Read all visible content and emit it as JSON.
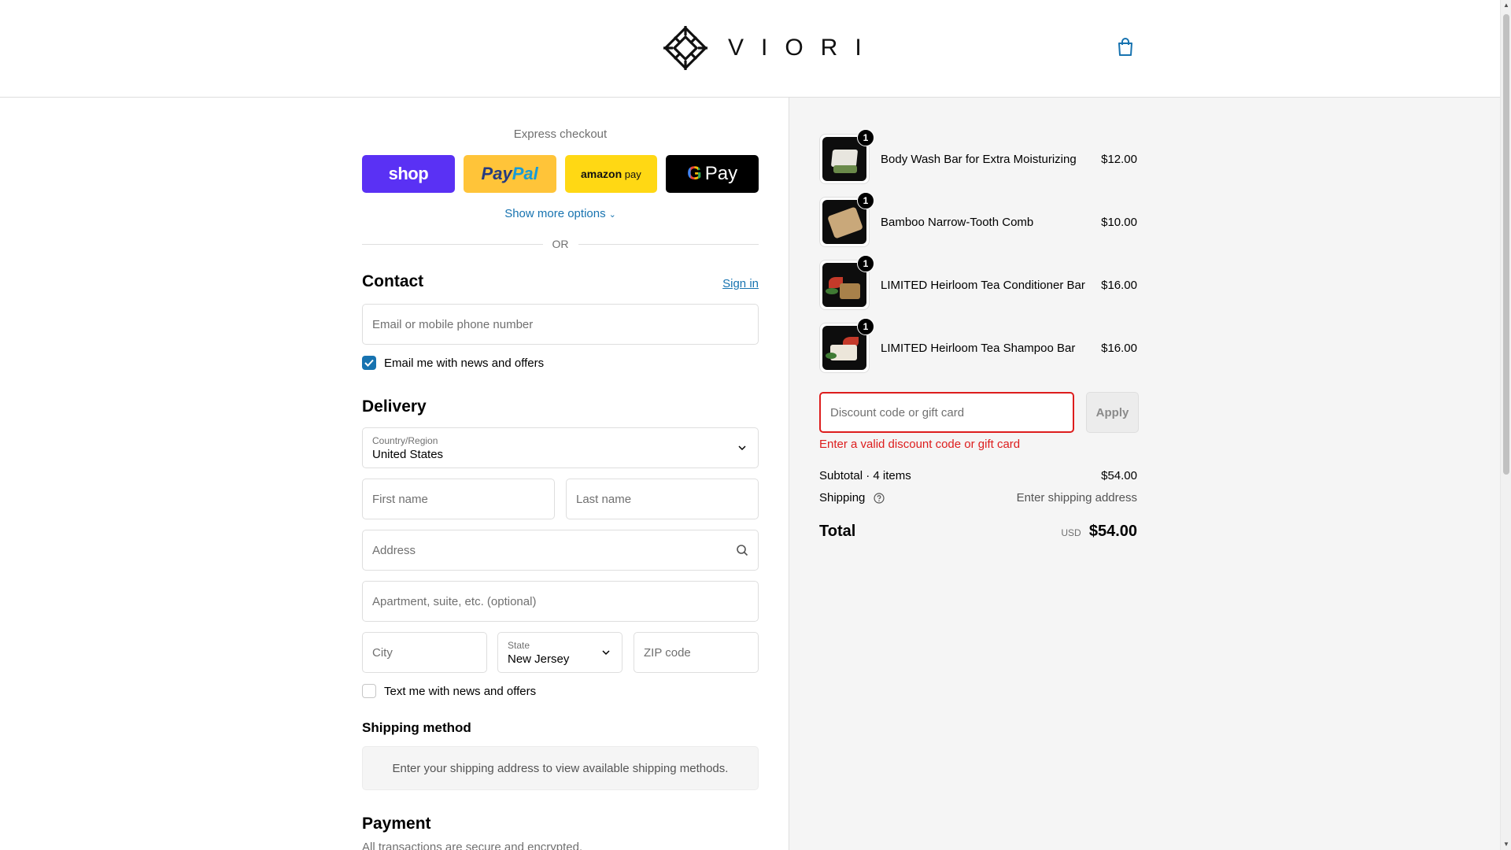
{
  "brand": {
    "name": "VIORI",
    "logo_icon": "viori-diamond-logo"
  },
  "header": {
    "cart_icon": "shopping-bag-icon"
  },
  "express": {
    "title": "Express checkout",
    "buttons": [
      {
        "id": "shop",
        "label": "shop"
      },
      {
        "id": "paypal",
        "label_a": "Pay",
        "label_b": "Pal"
      },
      {
        "id": "amazon",
        "label_a": "amazon",
        "label_b": "pay"
      },
      {
        "id": "gpay",
        "label_g": "G",
        "label": "Pay"
      }
    ],
    "more_options": "Show more options",
    "or": "OR"
  },
  "contact": {
    "title": "Contact",
    "signin": "Sign in",
    "email_placeholder": "Email or mobile phone number",
    "email_news": "Email me with news and offers",
    "email_news_checked": true
  },
  "delivery": {
    "title": "Delivery",
    "country_label": "Country/Region",
    "country_value": "United States",
    "first_name": "First name",
    "last_name": "Last name",
    "address": "Address",
    "apartment": "Apartment, suite, etc. (optional)",
    "city": "City",
    "state_label": "State",
    "state_value": "New Jersey",
    "zip": "ZIP code",
    "text_news": "Text me with news and offers",
    "text_news_checked": false
  },
  "shipping_method": {
    "title": "Shipping method",
    "info": "Enter your shipping address to view available shipping methods."
  },
  "payment": {
    "title": "Payment",
    "subtitle": "All transactions are secure and encrypted."
  },
  "summary": {
    "items": [
      {
        "name": "Body Wash Bar for Extra Moisturizing",
        "price": "$12.00",
        "qty": "1"
      },
      {
        "name": "Bamboo Narrow-Tooth Comb",
        "price": "$10.00",
        "qty": "1"
      },
      {
        "name": "LIMITED Heirloom Tea Conditioner Bar",
        "price": "$16.00",
        "qty": "1"
      },
      {
        "name": "LIMITED Heirloom Tea Shampoo Bar",
        "price": "$16.00",
        "qty": "1"
      }
    ],
    "discount_placeholder": "Discount code or gift card",
    "apply": "Apply",
    "discount_error": "Enter a valid discount code or gift card",
    "subtotal_label": "Subtotal · 4 items",
    "subtotal_value": "$54.00",
    "shipping_label": "Shipping",
    "shipping_value": "Enter shipping address",
    "total_label": "Total",
    "total_currency": "USD",
    "total_value": "$54.00"
  },
  "colors": {
    "link": "#1773b0",
    "error": "#dd1d1d",
    "shop_pay": "#5a31f4",
    "paypal": "#ffc439",
    "amazon_pay": "#ffd814"
  }
}
